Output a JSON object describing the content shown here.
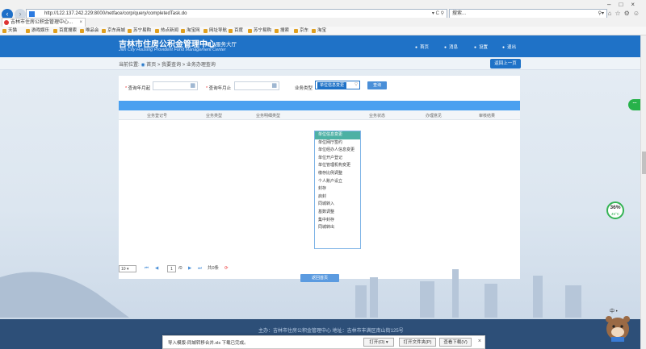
{
  "browser": {
    "url": "http://122.137.242.229:8000/netface/corp/query/completedTask.do",
    "search_placeholder": "搜索...",
    "tab_title": "吉林市住房公积金管理中心...",
    "favorites": [
      "天猫",
      "游戏娱乐",
      "百度搜索",
      "唯品会",
      "京东商城",
      "苏宁易购",
      "热点新闻",
      "淘宝网",
      "网址导航",
      "百度",
      "苏宁易购",
      "搜索",
      "京东",
      "淘宝"
    ]
  },
  "header": {
    "title": "吉林市住房公积金管理中心",
    "subtitle": "网上服务大厅",
    "title_en": "Jilin City Housing Provident Fund Management Center",
    "nav": [
      "首页",
      "消息",
      "设置",
      "退出"
    ]
  },
  "breadcrumb": {
    "prefix": "当前位置:",
    "path": "首页 > 我要查询 > 业务办理查询",
    "back_button": "返回上一页"
  },
  "filters": {
    "start_label": "查询年月起",
    "end_label": "查询年月止",
    "type_label": "业务类型",
    "type_selected": "单位信息变更",
    "query_button": "查询"
  },
  "table": {
    "columns": [
      "业务登记号",
      "业务类型",
      "业务明细类型",
      "业务状态",
      "办理意见",
      "审核结果"
    ]
  },
  "dropdown": {
    "options": [
      "单位信息变更",
      "单位网厅签约",
      "单位经办人信息变更",
      "单位开户登记",
      "单位管理机构变更",
      "缴存比例调整",
      "个人账户设立",
      "封存",
      "启封",
      "同城转入",
      "基数调整",
      "集中封存",
      "同城转出"
    ],
    "selected_index": 0
  },
  "pager": {
    "page_size": "10",
    "current_page": "1",
    "total_pages_text": "/0",
    "total_text": "共0条"
  },
  "return_button": "返回首页",
  "footer": {
    "text": "主办：吉林市住房公积金管理中心   地址：吉林市丰满区南山街125号"
  },
  "widgets": {
    "gauge_percent": "36%",
    "gauge_temp": "45°C",
    "bear_text": "中 •"
  },
  "download_bar": {
    "message": "导入模版-同城转移合并.xls 下载已完成。",
    "open": "打开(O)",
    "open_folder": "打开文件夹(P)",
    "view_downloads": "查看下载(V)"
  },
  "colors": {
    "brand_blue": "#1f72c7",
    "selected_option": "#4db1a4",
    "table_bar": "#4aa0f0"
  }
}
